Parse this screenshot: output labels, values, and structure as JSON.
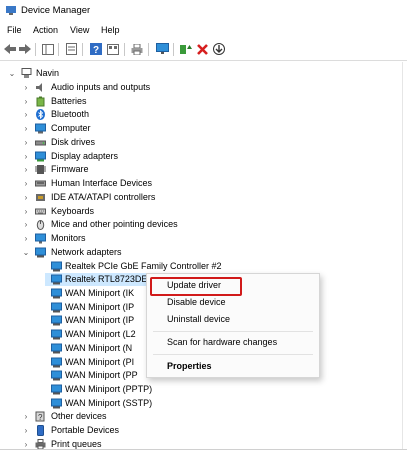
{
  "window": {
    "title": "Device Manager"
  },
  "menu": [
    "File",
    "Action",
    "View",
    "Help"
  ],
  "toolbar": {
    "buttons": [
      "back-arrow-icon",
      "forward-arrow-icon",
      "show-hide-tree-icon",
      "properties-icon",
      "help-icon",
      "update-view-icon",
      "print-icon",
      "scan-monitor-icon",
      "update-driver-icon",
      "uninstall-x-icon",
      "download-icon"
    ]
  },
  "tree": {
    "root": "Navin",
    "categories": [
      "Audio inputs and outputs",
      "Batteries",
      "Bluetooth",
      "Computer",
      "Disk drives",
      "Display adapters",
      "Firmware",
      "Human Interface Devices",
      "IDE ATA/ATAPI controllers",
      "Keyboards",
      "Mice and other pointing devices",
      "Monitors",
      "Network adapters"
    ],
    "network_children": [
      "Realtek PCIe GbE Family Controller #2",
      "Realtek RTL8723DE",
      "WAN Miniport (IK",
      "WAN Miniport (IP",
      "WAN Miniport (IP",
      "WAN Miniport (L2",
      "WAN Miniport (N",
      "WAN Miniport (PI",
      "WAN Miniport (PP",
      "WAN Miniport (PPTP)",
      "WAN Miniport (SSTP)"
    ],
    "after_categories": [
      "Other devices",
      "Portable Devices",
      "Print queues"
    ]
  },
  "context_menu": {
    "items": [
      "Update driver",
      "Disable device",
      "Uninstall device",
      "Scan for hardware changes",
      "Properties"
    ]
  },
  "colors": {
    "accent": "#0a64c8",
    "selection": "#cde8ff",
    "highlight_box": "#d11a1a"
  }
}
